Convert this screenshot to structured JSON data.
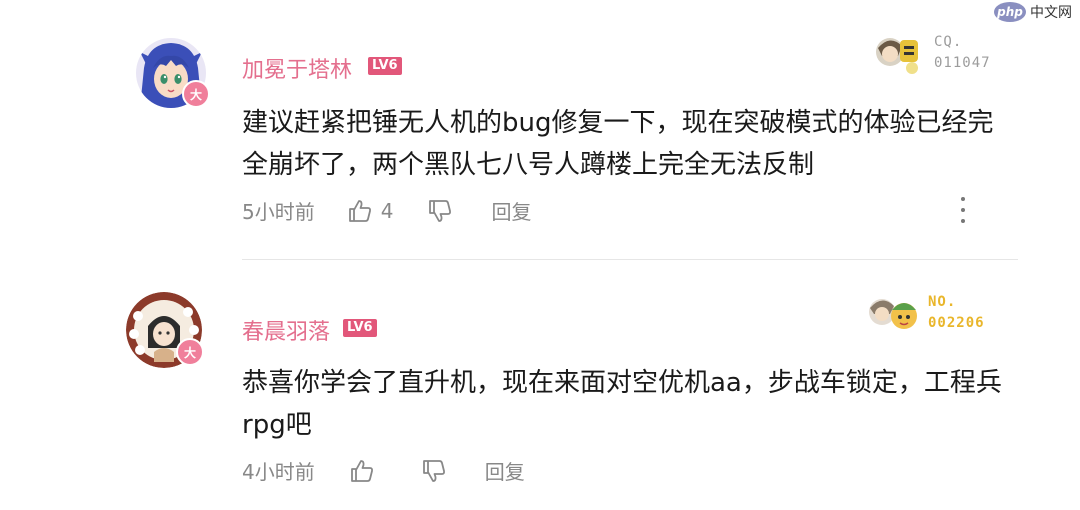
{
  "watermark": {
    "logo_text": "php",
    "site_name": "中文网"
  },
  "comments": [
    {
      "username": "加冕于塔林",
      "level": "LV6",
      "avatar_badge": "大",
      "medal": {
        "line1": "CQ.",
        "line2": "011047",
        "color": "#9c9c9c"
      },
      "content_line1": "建议赶紧把锤无人机的bug修复一下，现在突破模式的体验已经完",
      "content_line2": "全崩坏了，两个黑队七八号人蹲楼上完全无法反制",
      "time": "5小时前",
      "likes": "4",
      "reply_label": "回复"
    },
    {
      "username": "春晨羽落",
      "level": "LV6",
      "avatar_badge": "大",
      "medal": {
        "line1": "NO.",
        "line2": "002206",
        "color": "#e9b62b"
      },
      "content_line1": "恭喜你学会了直升机，现在来面对空优机aa，步战车锁定，工程兵",
      "content_line2": "rpg吧",
      "time": "4小时前",
      "likes": "",
      "reply_label": "回复"
    }
  ]
}
